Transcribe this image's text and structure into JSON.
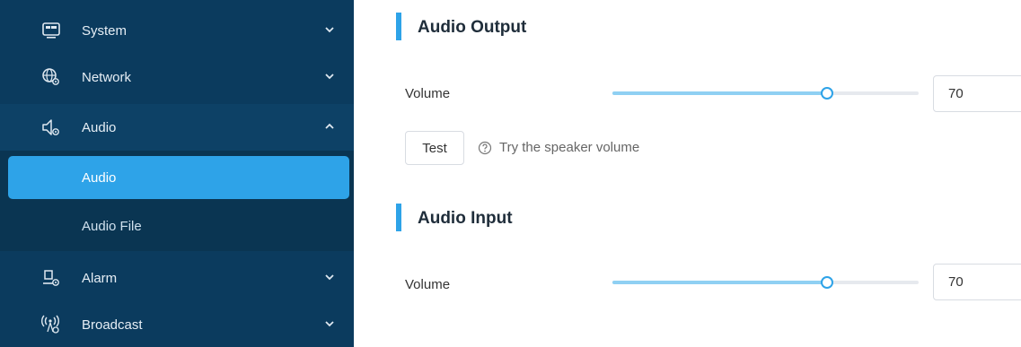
{
  "sidebar": {
    "items": [
      {
        "label": "System",
        "icon": "monitor-icon",
        "expanded": false
      },
      {
        "label": "Network",
        "icon": "globe-gear-icon",
        "expanded": false
      },
      {
        "label": "Audio",
        "icon": "speaker-gear-icon",
        "expanded": true
      },
      {
        "label": "Alarm",
        "icon": "alarm-gear-icon",
        "expanded": false
      },
      {
        "label": "Broadcast",
        "icon": "broadcast-gear-icon",
        "expanded": false
      }
    ],
    "audio_submenu": [
      {
        "label": "Audio",
        "active": true
      },
      {
        "label": "Audio File",
        "active": false
      }
    ]
  },
  "main": {
    "audio_output": {
      "title": "Audio Output",
      "volume_label": "Volume",
      "volume_value": "70",
      "volume_level": 70,
      "test_label": "Test",
      "hint": "Try the speaker volume"
    },
    "audio_input": {
      "title": "Audio Input",
      "volume_label": "Volume",
      "volume_value": "70",
      "volume_level": 70
    }
  },
  "colors": {
    "sidebar_bg": "#0b3b5e",
    "accent": "#2ea3e8",
    "slider_track": "#8fd0f3"
  }
}
